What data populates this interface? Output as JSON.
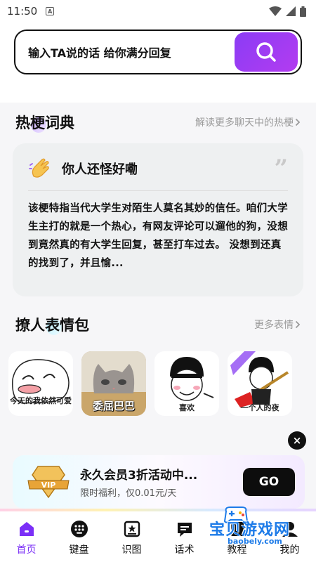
{
  "status_bar": {
    "time": "11:50",
    "notification_letter": "A"
  },
  "search": {
    "prompt": "输入TA说的话 给你满分回复"
  },
  "hot_meme": {
    "title": "热梗词典",
    "more": "解读更多聊天中的热梗",
    "card": {
      "title": "你人还怪好嘞",
      "body": "该梗特指当代大学生对陌生人莫名其妙的信任。咱们大学生主打的就是一个热心，有网友评论可以遛他的狗，没想到竟然真的有大学生回复，甚至打车过去。 没想到还真的找到了，并且愉..."
    }
  },
  "stickers": {
    "title": "撩人表情包",
    "more": "更多表情",
    "items": [
      {
        "caption": "今天的我依然可爱"
      },
      {
        "caption": "委屈巴巴"
      },
      {
        "caption": "喜欢"
      },
      {
        "caption": "一个人的夜"
      }
    ]
  },
  "vip_banner": {
    "badge": "VIP",
    "title": "永久会员3折活动中...",
    "subtitle": "限时福利，仅0.01元/天",
    "button": "GO"
  },
  "nav": {
    "items": [
      {
        "label": "首页",
        "icon": "home-icon"
      },
      {
        "label": "键盘",
        "icon": "keyboard-icon"
      },
      {
        "label": "识图",
        "icon": "image-icon"
      },
      {
        "label": "话术",
        "icon": "chat-icon"
      },
      {
        "label": "教程",
        "icon": "tutorial-icon"
      },
      {
        "label": "我的",
        "icon": "profile-icon"
      }
    ]
  },
  "watermark": {
    "text": "宝贝游戏网",
    "url": "baobely.com"
  },
  "colors": {
    "accent": "#8b3cf5",
    "nav_active": "#7b2ff7"
  }
}
